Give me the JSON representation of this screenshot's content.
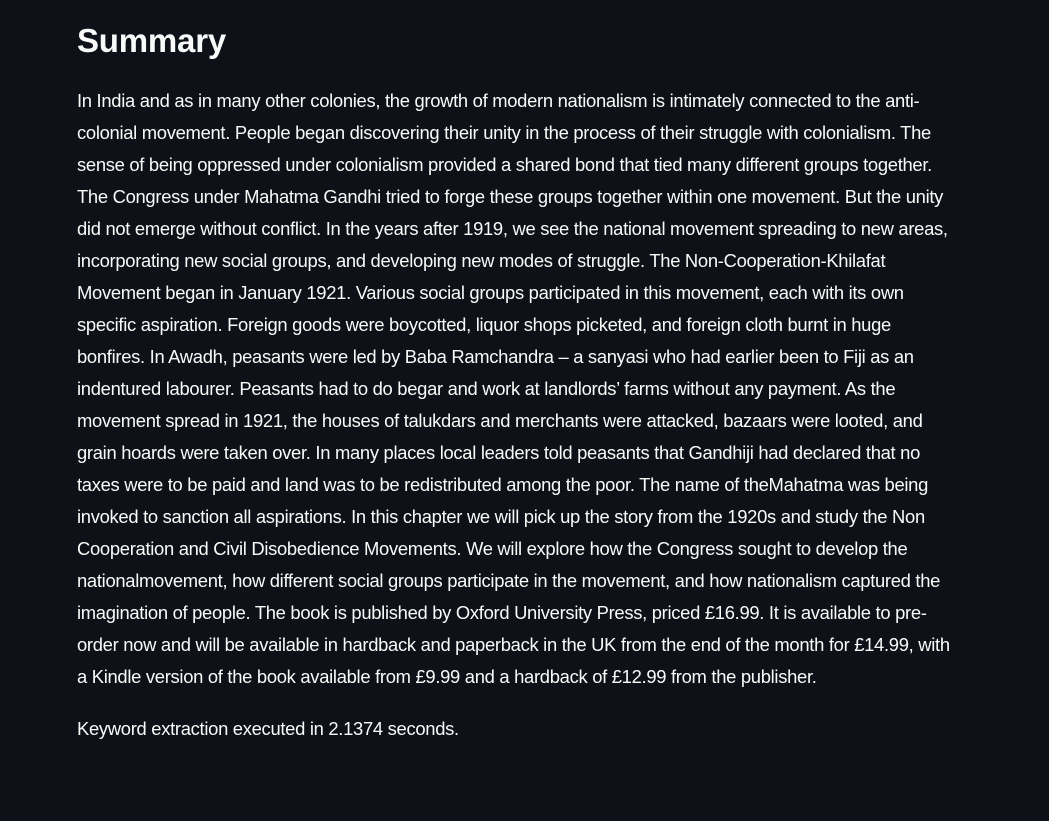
{
  "summary": {
    "heading": "Summary",
    "text": "In India and as in many other colonies, the growth of modern nationalism is intimately connected to the anti-colonial movement. People began discovering their unity in the process of their struggle with colonialism. The sense of being oppressed under colonialism provided a shared bond that tied many different groups together. The Congress under Mahatma Gandhi tried to forge these groups together within one movement. But the unity did not emerge without conflict. In the years after 1919, we see the national movement spreading to new areas, incorporating new social groups, and developing new modes of struggle. The Non-Cooperation-Khilafat Movement began in January 1921. Various social groups participated in this movement, each with its own specific aspiration. Foreign goods were boycotted, liquor shops picketed, and foreign cloth burnt in huge bonfires. In Awadh, peasants were led by Baba Ramchandra – a sanyasi who had earlier been to Fiji as an indentured labourer. Peasants had to do begar and work at landlords’ farms without any payment. As the movement spread in 1921, the houses of talukdars and merchants were attacked, bazaars were looted, and grain hoards were taken over. In many places local leaders told peasants that Gandhiji had declared that no taxes were to be paid and land was to be redistributed among the poor. The name of theMahatma was being invoked to sanction all aspirations. In this chapter we will pick up the story from the 1920s and study the Non Cooperation and Civil Disobedience Movements. We will explore how the Congress sought to develop the nationalmovement, how different social groups participate in the movement, and how nationalism captured the imagination of people. The book is published by Oxford University Press, priced £16.99. It is available to pre-order now and will be available in hardback and paperback in the UK from the end of the month for £14.99, with a Kindle version of the book available from £9.99 and a hardback of £12.99 from the publisher."
  },
  "status": {
    "timing_text": "Keyword extraction executed in 2.1374 seconds."
  },
  "colors": {
    "background": "#0e1117",
    "text": "#fafafa"
  }
}
